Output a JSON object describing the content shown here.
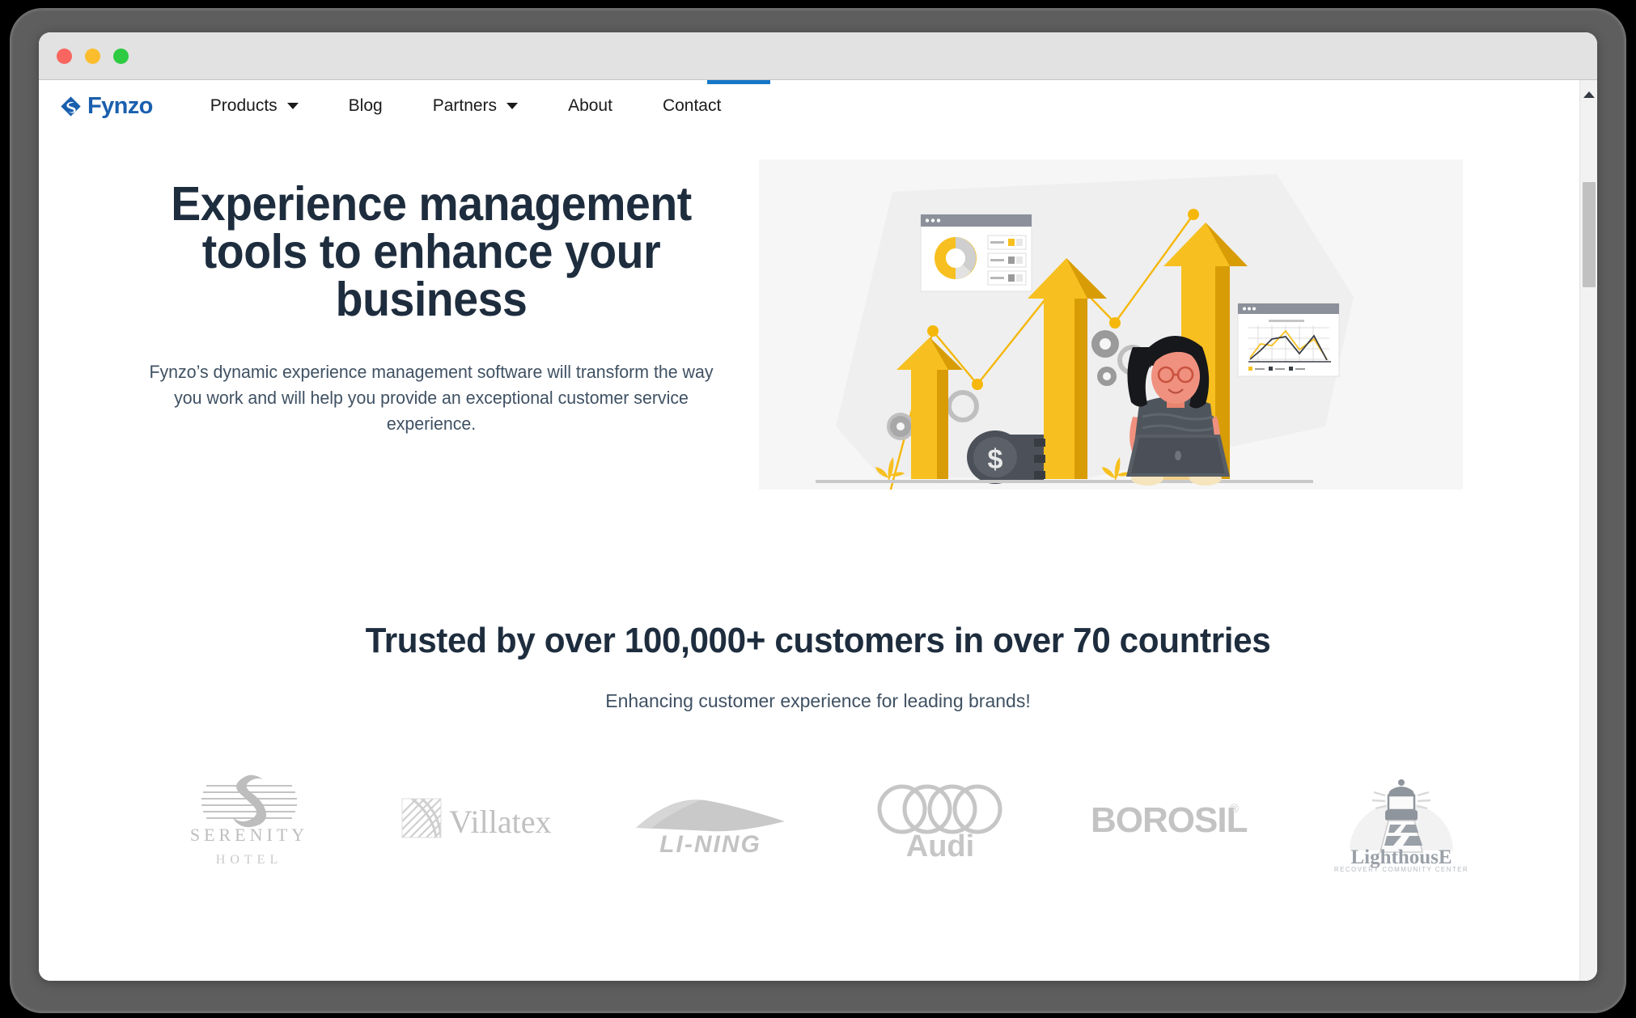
{
  "window": {
    "traffic_lights": [
      {
        "name": "close",
        "color": "#f9655f"
      },
      {
        "name": "minimize",
        "color": "#fbbd2e"
      },
      {
        "name": "maximize",
        "color": "#2dcb42"
      }
    ]
  },
  "header": {
    "brand": {
      "name": "Fynzo",
      "color": "#1a5fae",
      "icon": "fynzo-wave-diamond-icon"
    },
    "accent_color": "#1677c9",
    "nav": [
      {
        "label": "Products",
        "has_dropdown": true
      },
      {
        "label": "Blog",
        "has_dropdown": false
      },
      {
        "label": "Partners",
        "has_dropdown": true
      },
      {
        "label": "About",
        "has_dropdown": false
      },
      {
        "label": "Contact",
        "has_dropdown": false
      }
    ]
  },
  "hero": {
    "title": "Experience management tools to enhance your business",
    "subtitle": "Fynzo’s dynamic experience management software will transform the way you work and will help you provide an exceptional customer service experience.",
    "title_color": "#1e2d3e",
    "subtitle_color": "#3f5163",
    "illustration": {
      "name": "business-growth-illustration",
      "background": "#f6f6f6",
      "accent": "#f5b70a",
      "elements": [
        "growth-arrow-small",
        "growth-arrow-medium",
        "growth-arrow-large",
        "zigzag-line-chart",
        "donut-chart-card",
        "line-chart-card",
        "woman-with-laptop",
        "gears",
        "coin-stack-dollar",
        "plants"
      ]
    }
  },
  "trusted": {
    "title": "Trusted by over 100,000+ customers in over 70 countries",
    "subtitle": "Enhancing customer experience for leading brands!",
    "logos": [
      {
        "name": "serenity-hotel",
        "label": "SERENITY",
        "sublabel": "HOTEL"
      },
      {
        "name": "villatex",
        "label": "Villatex",
        "sublabel": ""
      },
      {
        "name": "li-ning",
        "label": "LI-NING",
        "sublabel": ""
      },
      {
        "name": "audi",
        "label": "Audi",
        "sublabel": ""
      },
      {
        "name": "borosil",
        "label": "BOROSIL",
        "sublabel": "®"
      },
      {
        "name": "lighthouse",
        "label": "LighthousE",
        "sublabel": "RECOVERY COMMUNITY CENTER"
      }
    ],
    "logo_color": "#c3c3c3"
  },
  "scrollbar": {
    "position": "right",
    "thumb_color": "#c1c1c1"
  }
}
